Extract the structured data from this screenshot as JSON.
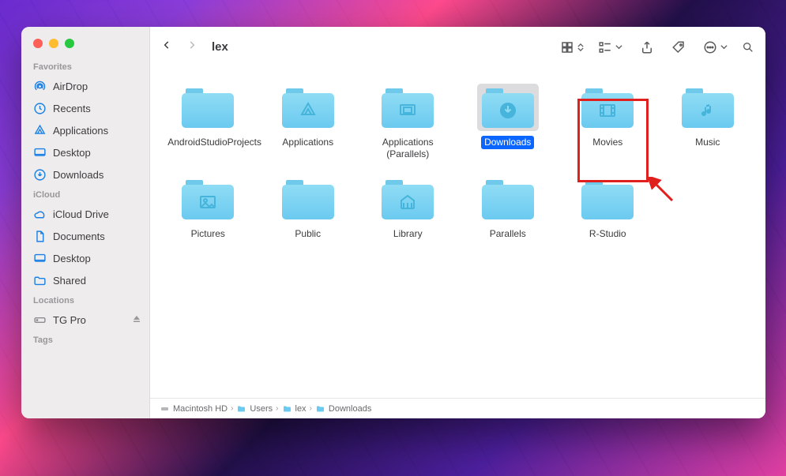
{
  "window": {
    "title": "lex"
  },
  "sidebar": {
    "sections": {
      "favorites": {
        "label": "Favorites",
        "items": [
          {
            "label": "AirDrop",
            "icon": "airdrop"
          },
          {
            "label": "Recents",
            "icon": "clock"
          },
          {
            "label": "Applications",
            "icon": "apps"
          },
          {
            "label": "Desktop",
            "icon": "desktop"
          },
          {
            "label": "Downloads",
            "icon": "download"
          }
        ]
      },
      "icloud": {
        "label": "iCloud",
        "items": [
          {
            "label": "iCloud Drive",
            "icon": "cloud"
          },
          {
            "label": "Documents",
            "icon": "document"
          },
          {
            "label": "Desktop",
            "icon": "desktop"
          },
          {
            "label": "Shared",
            "icon": "shared-folder"
          }
        ]
      },
      "locations": {
        "label": "Locations",
        "items": [
          {
            "label": "TG Pro",
            "icon": "disk",
            "eject": true
          }
        ]
      },
      "tags": {
        "label": "Tags"
      }
    }
  },
  "folders": {
    "row1": [
      {
        "label": "AndroidStudioProjects",
        "glyph": "none"
      },
      {
        "label": "Applications",
        "glyph": "apps"
      },
      {
        "label": "Applications (Parallels)",
        "glyph": "monitor"
      },
      {
        "label": "Downloads",
        "glyph": "download",
        "selected": true
      },
      {
        "label": "Movies",
        "glyph": "movie"
      },
      {
        "label": "Music",
        "glyph": "music"
      }
    ],
    "row2": [
      {
        "label": "Pictures",
        "glyph": "picture"
      },
      {
        "label": "Public",
        "glyph": "none"
      },
      {
        "label": "Library",
        "glyph": "library"
      },
      {
        "label": "Parallels",
        "glyph": "none"
      },
      {
        "label": "R-Studio",
        "glyph": "none"
      }
    ]
  },
  "path": {
    "crumbs": [
      {
        "label": "Macintosh HD",
        "icon": "disk"
      },
      {
        "label": "Users",
        "icon": "folder"
      },
      {
        "label": "lex",
        "icon": "folder"
      },
      {
        "label": "Downloads",
        "icon": "folder"
      }
    ]
  }
}
